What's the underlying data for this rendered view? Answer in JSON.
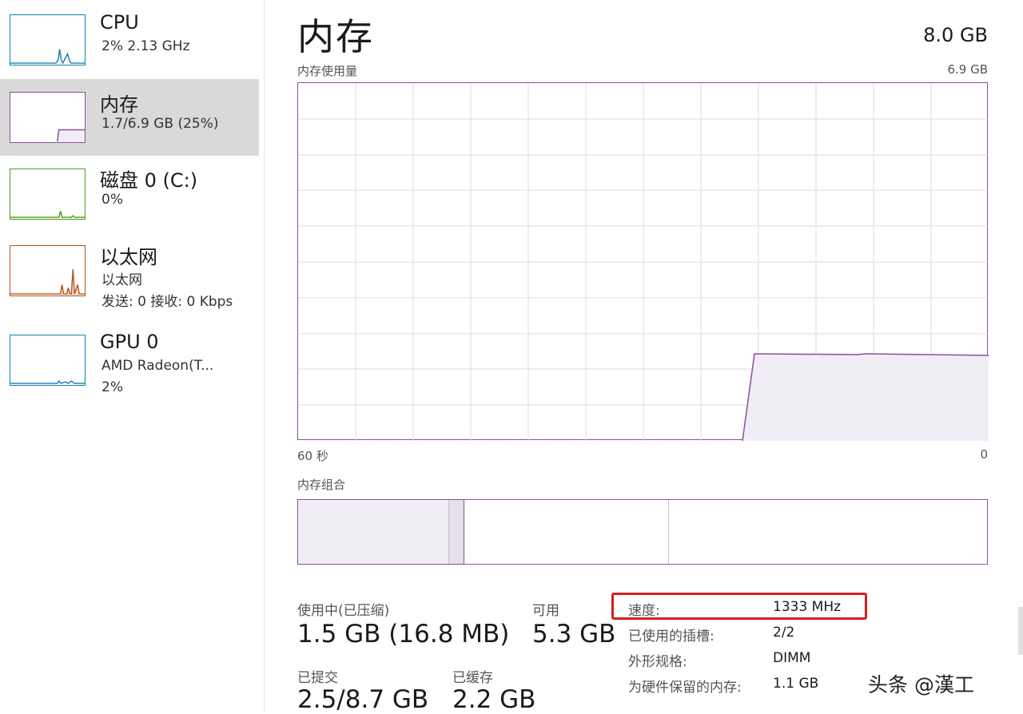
{
  "sidebar": {
    "items": [
      {
        "title": "CPU",
        "lines": [
          "2% 2.13 GHz"
        ],
        "color": "#1a7fb5",
        "selected": false
      },
      {
        "title": "内存",
        "lines": [
          "1.7/6.9 GB (25%)"
        ],
        "color": "#8a4f9e",
        "selected": true
      },
      {
        "title": "磁盘 0 (C:)",
        "lines": [
          "0%"
        ],
        "color": "#4d9a1a",
        "selected": false
      },
      {
        "title": "以太网",
        "lines": [
          "以太网",
          "发送: 0 接收: 0 Kbps"
        ],
        "color": "#b5561a",
        "selected": false
      },
      {
        "title": "GPU 0",
        "lines": [
          "AMD Radeon(T...",
          "2%"
        ],
        "color": "#1a7fb5",
        "selected": false
      }
    ]
  },
  "main": {
    "title": "内存",
    "total": "8.0 GB",
    "usage_chart": {
      "label": "内存使用量",
      "max_label": "6.9 GB",
      "time_left": "60 秒",
      "time_right": "0",
      "accent": "#8a4f9e",
      "fill": "#f1edf4"
    },
    "composition": {
      "label": "内存组合"
    },
    "stats": {
      "in_use_label": "使用中(已压缩)",
      "in_use_value": "1.5 GB (16.8 MB)",
      "available_label": "可用",
      "available_value": "5.3 GB",
      "committed_label": "已提交",
      "committed_value": "2.5/8.7 GB",
      "cached_label": "已缓存",
      "cached_value": "2.2 GB"
    },
    "details": [
      {
        "key": "速度:",
        "value": "1333 MHz"
      },
      {
        "key": "已使用的插槽:",
        "value": "2/2"
      },
      {
        "key": "外形规格:",
        "value": "DIMM"
      },
      {
        "key": "为硬件保留的内存:",
        "value": "1.1 GB"
      }
    ]
  },
  "watermark": "头条 @漢工"
}
